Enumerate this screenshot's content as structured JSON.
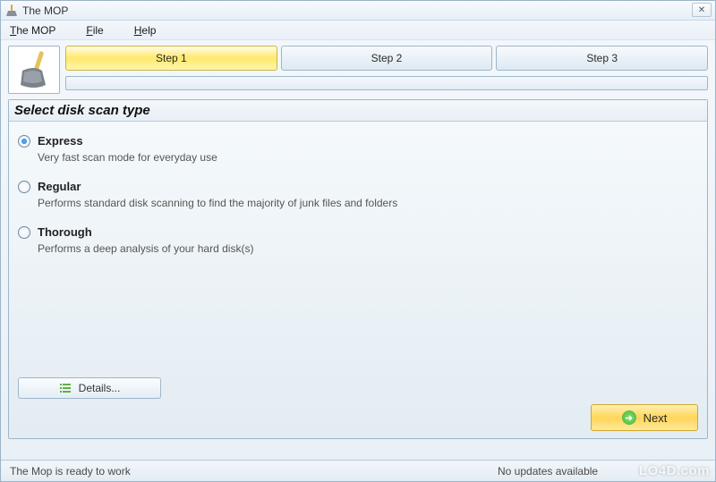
{
  "window": {
    "title": "The MOP",
    "close_glyph": "✕"
  },
  "menu": {
    "items": [
      {
        "accel": "T",
        "rest": "he MOP"
      },
      {
        "accel": "F",
        "rest": "ile"
      },
      {
        "accel": "H",
        "rest": "elp"
      }
    ]
  },
  "steps": {
    "tabs": [
      "Step 1",
      "Step 2",
      "Step 3"
    ],
    "active_index": 0
  },
  "panel": {
    "title": "Select disk scan type",
    "options": [
      {
        "label": "Express",
        "desc": "Very fast scan mode for everyday use",
        "checked": true
      },
      {
        "label": "Regular",
        "desc": "Performs standard disk scanning to find the majority of junk files and folders",
        "checked": false
      },
      {
        "label": "Thorough",
        "desc": "Performs a deep analysis of your hard disk(s)",
        "checked": false
      }
    ],
    "details_label": "Details...",
    "next_label": "Next",
    "next_arrow": "➜"
  },
  "status": {
    "left": "The Mop is ready to work",
    "updates": "No updates available"
  },
  "watermark": "LO4D.com"
}
